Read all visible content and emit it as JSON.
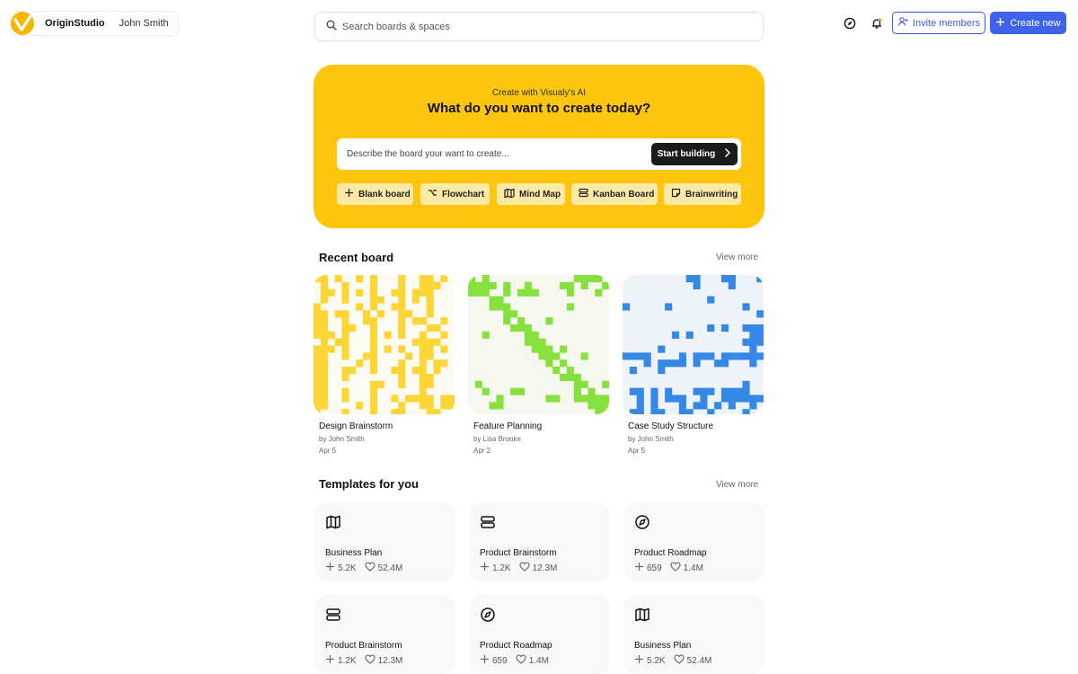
{
  "header": {
    "org_name": "OriginStudio",
    "user_name": "John Smith",
    "search_placeholder": "Search boards & spaces",
    "invite_label": "Invite members",
    "create_label": "Create new",
    "icons": [
      "compass-icon",
      "bell-icon"
    ],
    "accent": "#3d63e8"
  },
  "hero": {
    "subtitle": "Create with Visualy's AI",
    "title": "What do you want to create today?",
    "prompt_placeholder": "Describe the board your want to create...",
    "start_label": "Start building",
    "background": "#fdc50c",
    "chips": [
      {
        "label": "Blank board",
        "icon": "plus-icon"
      },
      {
        "label": "Flowchart",
        "icon": "flowchart-icon"
      },
      {
        "label": "Mind Map",
        "icon": "map-icon"
      },
      {
        "label": "Kanban Board",
        "icon": "kanban-icon"
      },
      {
        "label": "Brainwriting",
        "icon": "note-icon"
      }
    ]
  },
  "recent": {
    "title": "Recent board",
    "view_more": "View more",
    "boards": [
      {
        "name": "Design Brainstorm",
        "author": "by John Smith",
        "date": "Apr 5",
        "color": "#fdd535"
      },
      {
        "name": "Feature Planning",
        "author": "by Lisa Brooke",
        "date": "Apr 2",
        "color": "#86e03d"
      },
      {
        "name": "Case Study Structure",
        "author": "by John Smith",
        "date": "Apr 5",
        "color": "#3588e5"
      }
    ]
  },
  "templates": {
    "title": "Templates for you",
    "view_more": "View more",
    "items": [
      {
        "name": "Business Plan",
        "uses": "5.2K",
        "likes": "52.4M",
        "icon": "map-icon"
      },
      {
        "name": "Product Brainstorm",
        "uses": "1.2K",
        "likes": "12.3M",
        "icon": "kanban-icon"
      },
      {
        "name": "Product Roadmap",
        "uses": "659",
        "likes": "1.4M",
        "icon": "compass-icon"
      },
      {
        "name": "Product Brainstorm",
        "uses": "1.2K",
        "likes": "12.3M",
        "icon": "kanban-icon"
      },
      {
        "name": "Product Roadmap",
        "uses": "659",
        "likes": "1.4M",
        "icon": "compass-icon"
      },
      {
        "name": "Business Plan",
        "uses": "5.2K",
        "likes": "52.4M",
        "icon": "map-icon"
      }
    ]
  }
}
